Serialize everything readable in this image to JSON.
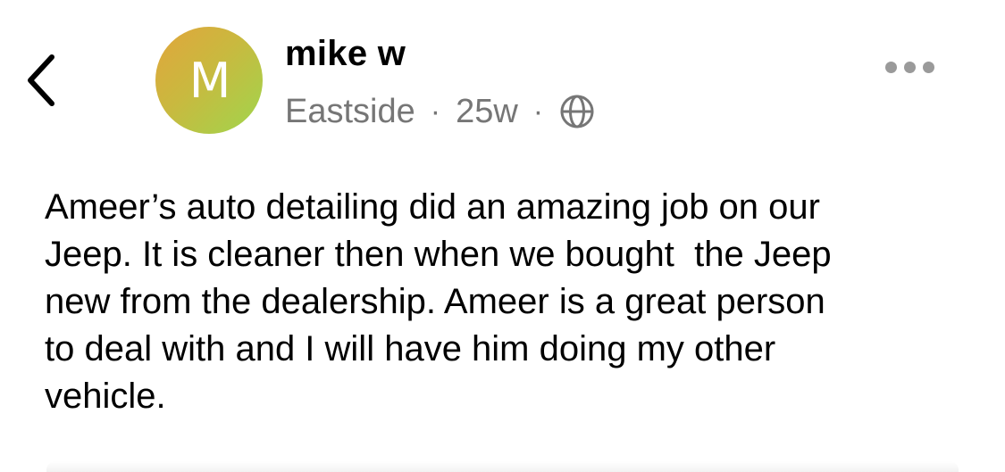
{
  "header": {
    "back_icon": "chevron-left-icon",
    "avatar_letter": "M",
    "user_name": "mike w",
    "location": "Eastside",
    "separator": "·",
    "time_ago": "25w",
    "visibility_icon": "globe-icon",
    "more_icon": "ellipsis-icon"
  },
  "post": {
    "text": "Ameer’s auto detailing did an amazing job on our\nJeep. It is cleaner then when we bought  the Jeep\nnew from the dealership. Ameer is a great person\nto deal with and I will have him doing my other\nvehicle."
  },
  "colors": {
    "avatar_gradient_start": "#e2a53c",
    "avatar_gradient_end": "#9fd64d",
    "meta_text": "#767676",
    "more_dots": "#9a9a9a"
  }
}
